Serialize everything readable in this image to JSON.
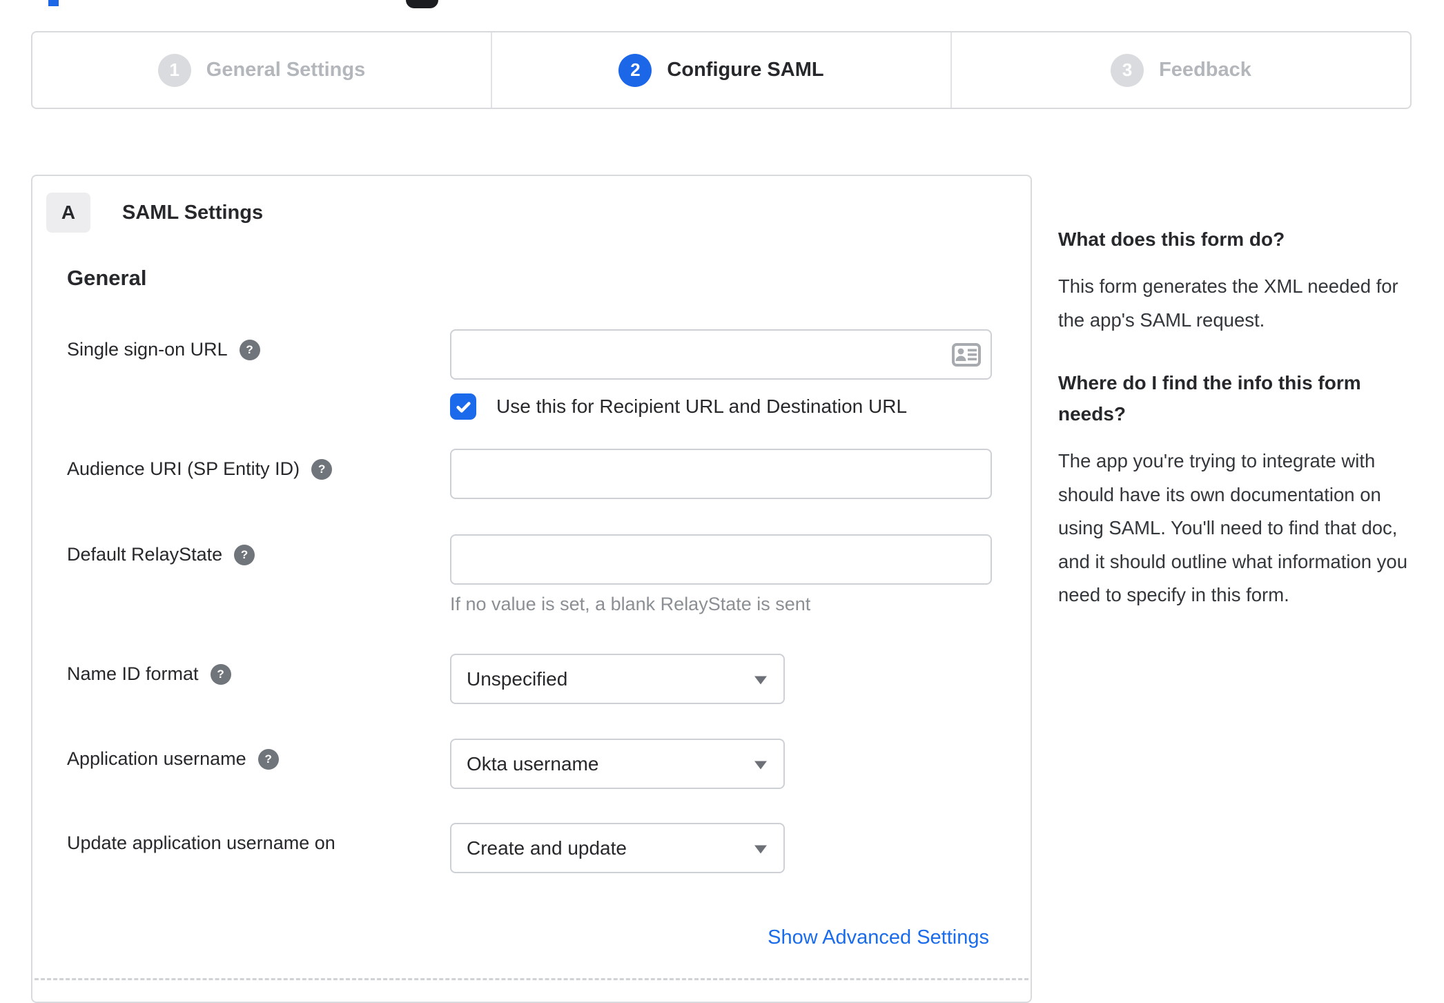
{
  "colors": {
    "accent_blue": "#1b67e8",
    "checkbox_blue": "#1b6aeb",
    "link_blue": "#1a6cea",
    "text_dark": "#26282b",
    "text_muted": "#8b8f94",
    "step_inactive_text": "#b3b6bb",
    "step_inactive_circle": "#d9dbde",
    "border": "#d8dadd"
  },
  "stepper": {
    "steps": [
      {
        "number": "1",
        "label": "General Settings"
      },
      {
        "number": "2",
        "label": "Configure SAML"
      },
      {
        "number": "3",
        "label": "Feedback"
      }
    ],
    "active_step": "Configure SAML"
  },
  "panel": {
    "badge": "A",
    "title": "SAML Settings",
    "section_heading": "General",
    "fields": {
      "sso_url": {
        "label": "Single sign-on URL",
        "value": "",
        "checkbox_label": "Use this for Recipient URL and Destination URL",
        "checkbox_checked": true
      },
      "audience_uri": {
        "label": "Audience URI (SP Entity ID)",
        "value": ""
      },
      "default_relay_state": {
        "label": "Default RelayState",
        "value": "",
        "hint": "If no value is set, a blank RelayState is sent"
      },
      "name_id_format": {
        "label": "Name ID format",
        "value": "Unspecified"
      },
      "application_username": {
        "label": "Application username",
        "value": "Okta username"
      },
      "update_app_username": {
        "label": "Update application username on",
        "value": "Create and update"
      }
    },
    "advanced_link": "Show Advanced Settings"
  },
  "sidebar": {
    "sections": [
      {
        "title": "What does this form do?",
        "body": "This form generates the XML needed for the app's SAML request."
      },
      {
        "title": "Where do I find the info this form needs?",
        "body": "The app you're trying to integrate with should have its own documentation on using SAML. You'll need to find that doc, and it should outline what information you need to specify in this form."
      }
    ]
  }
}
